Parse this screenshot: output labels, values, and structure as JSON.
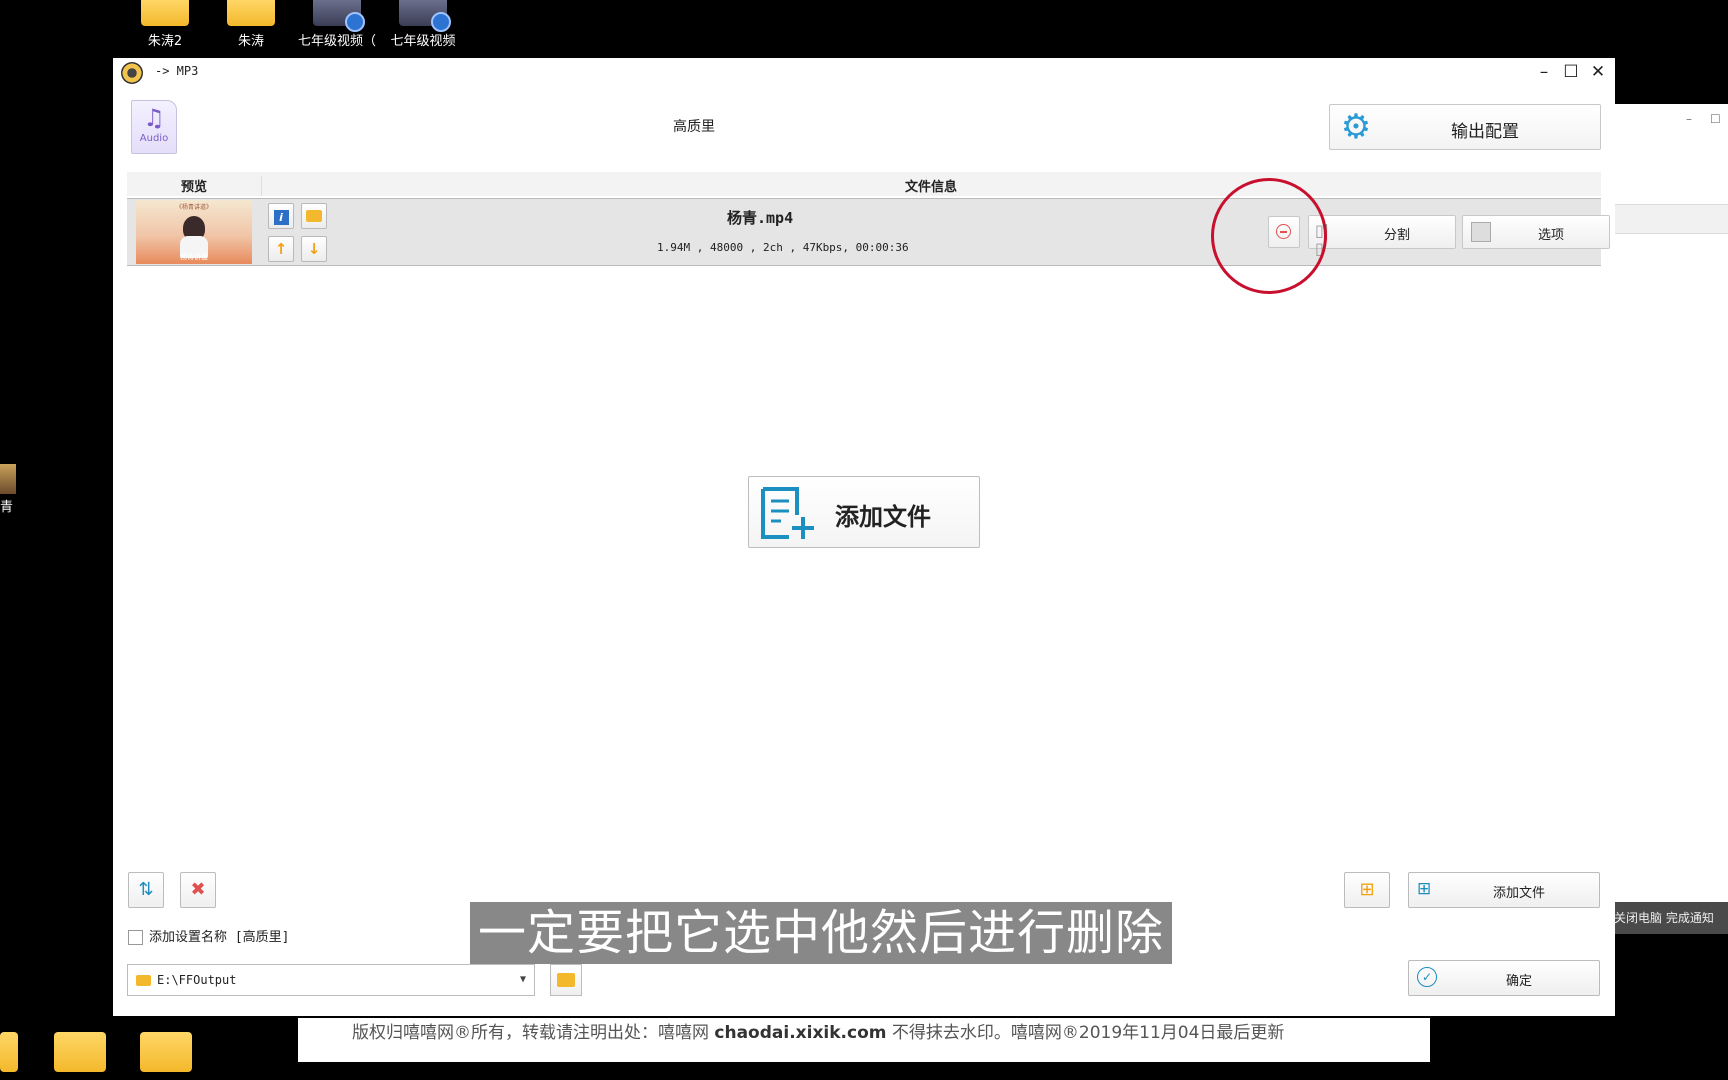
{
  "desktop": {
    "top_icons": [
      {
        "label": "朱涛2",
        "type": "folder"
      },
      {
        "label": "朱涛",
        "type": "folder"
      },
      {
        "label": "七年级视频（",
        "type": "video"
      },
      {
        "label": "七年级视频",
        "type": "video"
      }
    ],
    "left_edge_label": "青"
  },
  "background_window": {
    "checkbox_strip": "关闭电脑  完成通知"
  },
  "browser_footer": {
    "text_before": "版权归嘻嘻网®所有，转载请注明出处：嘻嘻网 ",
    "domain": "chaodai.xixik.com",
    "text_after": " 不得抹去水印。嘻嘻网®2019年11月04日最后更新"
  },
  "window": {
    "title": "-> MP3",
    "minimize": "–",
    "maximize": "☐",
    "close": "✕",
    "profile_icon_label": "Audio",
    "profile_name": "高质里",
    "output_config_label": "输出配置"
  },
  "file_list": {
    "header_preview": "预览",
    "header_info": "文件信息",
    "rows": [
      {
        "thumb_caption_top": "《杨青讲道》",
        "thumb_caption": "杨青讲道",
        "filename": "杨青.mp4",
        "meta": "1.94M , 48000 , 2ch , 47Kbps, 00:00:36"
      }
    ],
    "split_label": "分割",
    "options_label": "选项"
  },
  "center": {
    "add_file_label": "添加文件"
  },
  "footer": {
    "add_setting_name_label": "添加设置名称 [高质里]",
    "output_path": "E:\\FFOutput",
    "add_file_label": "添加文件",
    "ok_label": "确定"
  },
  "subtitle": "一定要把它选中他然后进行删除"
}
